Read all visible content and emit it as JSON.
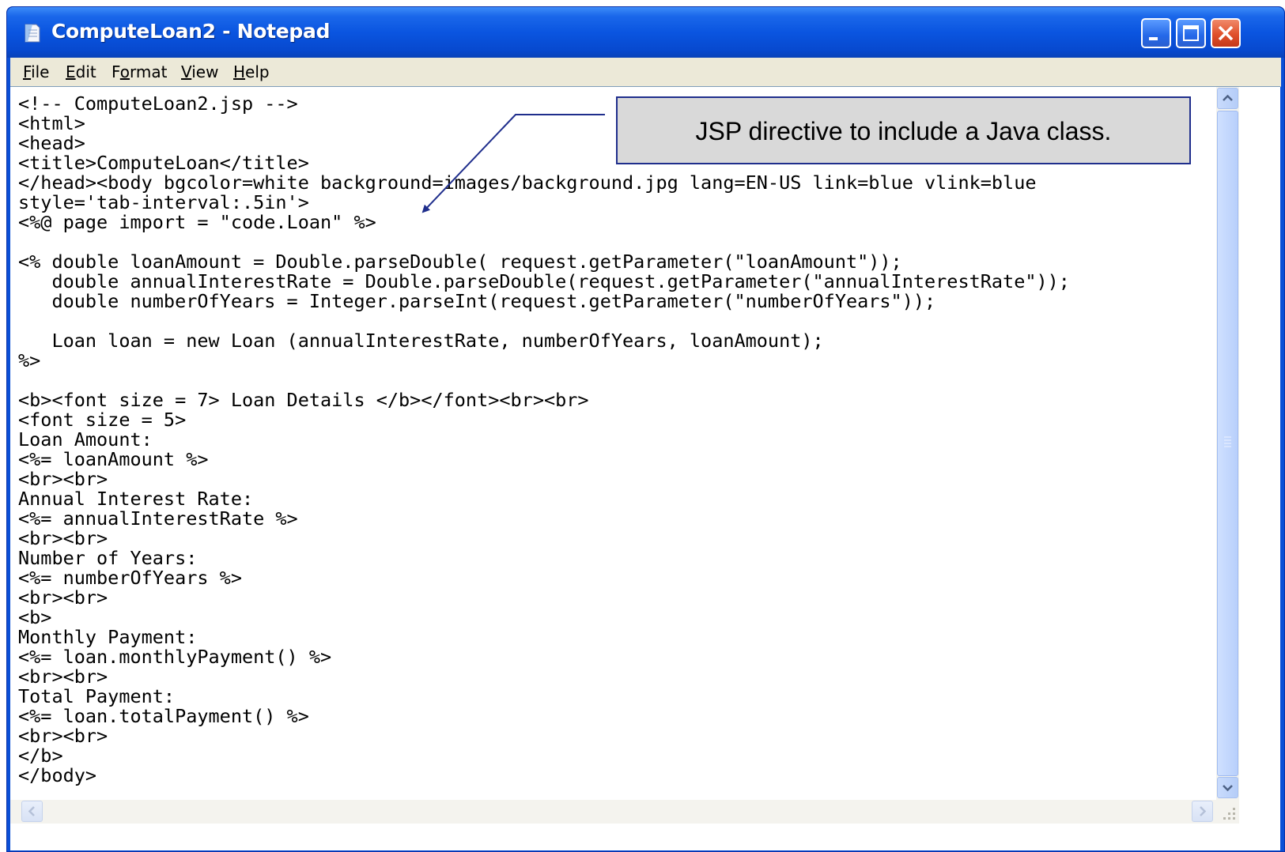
{
  "window": {
    "title": "ComputeLoan2 - Notepad"
  },
  "menu": {
    "items": [
      {
        "label": "File",
        "accel": "F",
        "rest": "ile"
      },
      {
        "label": "Edit",
        "accel": "E",
        "rest": "dit"
      },
      {
        "label": "Format",
        "accel": "o",
        "pre": "F",
        "rest": "rmat"
      },
      {
        "label": "View",
        "accel": "V",
        "rest": "iew"
      },
      {
        "label": "Help",
        "accel": "H",
        "rest": "elp"
      }
    ]
  },
  "editor": {
    "lines": [
      "<!-- ComputeLoan2.jsp -->",
      "<html>",
      "<head>",
      "<title>ComputeLoan</title>",
      "</head><body bgcolor=white background=images/background.jpg lang=EN-US link=blue vlink=blue",
      "style='tab-interval:.5in'>",
      "<%@ page import = \"code.Loan\" %>",
      "",
      "<% double loanAmount = Double.parseDouble( request.getParameter(\"loanAmount\"));",
      "   double annualInterestRate = Double.parseDouble(request.getParameter(\"annualInterestRate\"));",
      "   double numberOfYears = Integer.parseInt(request.getParameter(\"numberOfYears\"));",
      "",
      "   Loan loan = new Loan (annualInterestRate, numberOfYears, loanAmount);",
      "%>",
      "",
      "<b><font size = 7> Loan Details </b></font><br><br>",
      "<font size = 5>",
      "Loan Amount:",
      "<%= loanAmount %>",
      "<br><br>",
      "Annual Interest Rate:",
      "<%= annualInterestRate %>",
      "<br><br>",
      "Number of Years:",
      "<%= numberOfYears %>",
      "<br><br>",
      "<b>",
      "Monthly Payment:",
      "<%= loan.monthlyPayment() %>",
      "<br><br>",
      "Total Payment:",
      "<%= loan.totalPayment() %>",
      "<br><br>",
      "</b>",
      "</body>"
    ]
  },
  "callout": {
    "text": "JSP directive to include a Java class."
  },
  "colors": {
    "titlebar": "#0a55e0",
    "callout_border": "#1f2e8c",
    "callout_fill": "#d9d9d9",
    "arrow": "#1f2e8c"
  },
  "icons": {
    "app": "notepad-icon",
    "minimize": "minimize-icon",
    "maximize": "maximize-icon",
    "close": "close-icon"
  }
}
